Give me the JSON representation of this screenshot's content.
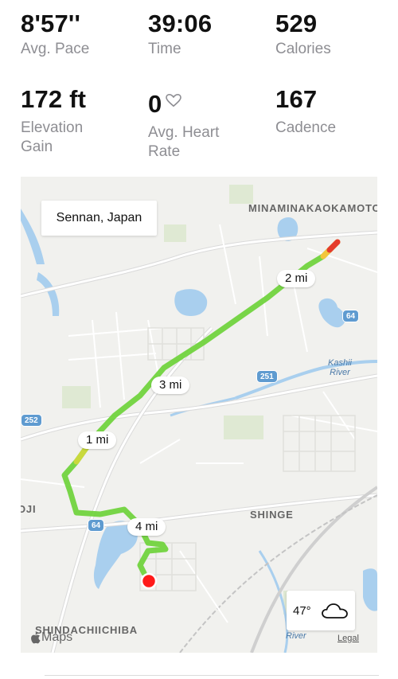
{
  "stats": [
    {
      "value": "8'57''",
      "label": "Avg. Pace"
    },
    {
      "value": "39:06",
      "label": "Time"
    },
    {
      "value": "529",
      "label": "Calories"
    },
    {
      "value": "172 ft",
      "label_line1": "Elevation",
      "label_line2": "Gain"
    },
    {
      "value": "0",
      "label_line1": "Avg. Heart",
      "label_line2": "Rate",
      "icon": "heart-outline-icon"
    },
    {
      "value": "167",
      "label": "Cadence"
    }
  ],
  "map": {
    "location": "Sennan, Japan",
    "mile_markers": [
      "1 mi",
      "2 mi",
      "3 mi",
      "4 mi"
    ],
    "places": [
      "MINAMINAKAOKAMOTO",
      "SHINGE",
      "SHINDACHIICHIBA",
      "OJI"
    ],
    "water_labels": {
      "kashii_1": "Kashii",
      "kashii_2": "River",
      "river": "River"
    },
    "road_shields": [
      "64",
      "251",
      "252",
      "64"
    ],
    "weather": {
      "temp": "47°",
      "icon": "cloud-icon"
    },
    "attribution": "Maps",
    "legal": "Legal",
    "colors": {
      "route_green": "#6ed23a",
      "route_red": "#e53b2c",
      "route_yellow": "#f3c63a",
      "end_marker": "#ff1a1a",
      "water": "#a9cfee"
    }
  }
}
